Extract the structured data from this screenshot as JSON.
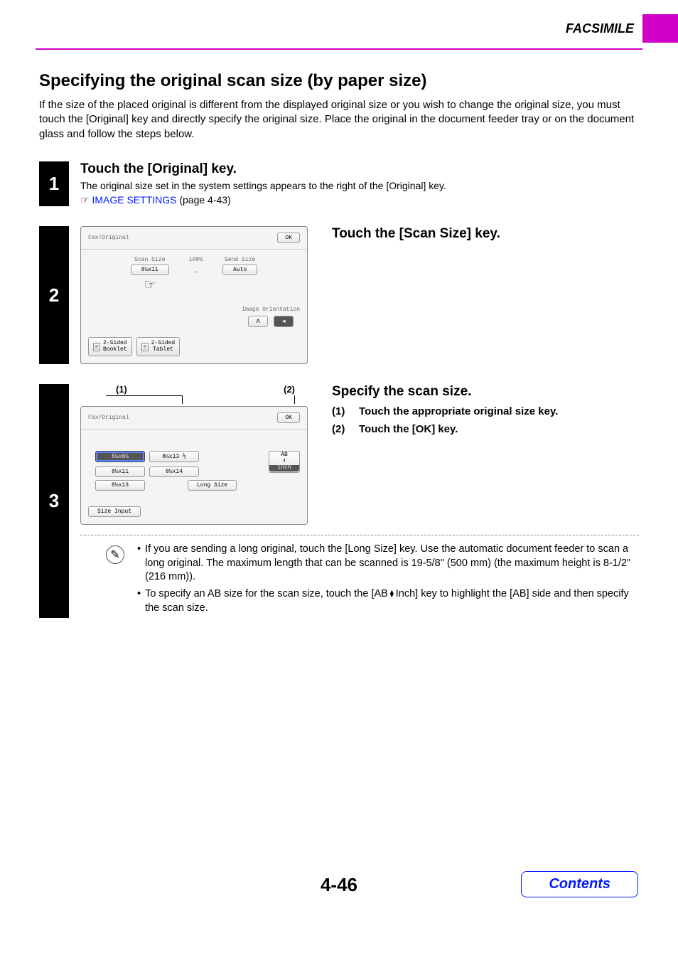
{
  "header": {
    "section": "FACSIMILE"
  },
  "topic": {
    "title": "Specifying the original scan size (by paper size)",
    "intro": "If the size of the placed original is different from the displayed original size or you wish to change the original size, you must touch the [Original] key and directly specify the original size. Place the original in the document feeder tray or on the document glass and follow the steps below."
  },
  "step1": {
    "num": "1",
    "title": "Touch the [Original] key.",
    "desc": "The original size set in the system settings appears to the right of the [Original] key.",
    "pointer": "☞",
    "link_text": "IMAGE SETTINGS",
    "link_suffix": " (page 4-43)"
  },
  "step2": {
    "num": "2",
    "title": "Touch the [Scan Size] key.",
    "screen": {
      "title": "Fax/Original",
      "ok": "OK",
      "scan_label": "Scan Size",
      "scan_value": "8½x11",
      "ratio": "100%",
      "send_label": "Send Size",
      "send_value": "Auto",
      "orient_label": "Image Orientation",
      "orient_a": "A",
      "orient_b": "◄",
      "btn1_line1": "2-Sided",
      "btn1_line2": "Booklet",
      "btn2_line1": "2-Sided",
      "btn2_line2": "Tablet"
    }
  },
  "step3": {
    "num": "3",
    "title": "Specify the scan size.",
    "sub1_num": "(1)",
    "sub1_txt": "Touch the appropriate original size key.",
    "sub2_num": "(2)",
    "sub2_txt": "Touch the [OK] key.",
    "callout1": "(1)",
    "callout2": "(2)",
    "screen": {
      "title": "Fax/Original",
      "ok": "OK",
      "sizes": [
        "5½x8½",
        "8½x13 ⅖",
        "8½x11",
        "8½x14",
        "8½x13"
      ],
      "long_size": "Long Size",
      "ab": "AB",
      "inch": "Inch",
      "size_input": "Size Input"
    },
    "notes": {
      "n1": "If you are sending a long original, touch the [Long Size] key. Use the automatic document feeder to scan a long original. The maximum length that can be scanned is 19-5/8\" (500 mm) (the maximum height is 8-1/2\" (216 mm)).",
      "n2a": "To specify an AB size for the scan size, touch the [AB",
      "n2b": "Inch] key to highlight the [AB] side and then specify the scan size."
    }
  },
  "footer": {
    "pagenum": "4-46",
    "contents": "Contents"
  }
}
